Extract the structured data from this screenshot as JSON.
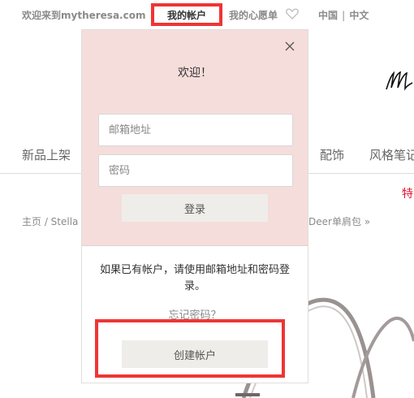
{
  "header": {
    "welcome": "欢迎来到mytheresa.com",
    "my_account": "我的帐户",
    "wishlist": "我的心愿单",
    "country": "中国",
    "language": "中文",
    "separator": "|"
  },
  "nav": {
    "new_arrivals": "新品上架",
    "accessories": "配饰",
    "style_notes": "风格笔记"
  },
  "promo": {
    "text": "特"
  },
  "breadcrumb": {
    "left": "主页 / Stella",
    "right": "Deer单肩包 »"
  },
  "login_popup": {
    "title": "欢迎！",
    "email_placeholder": "邮箱地址",
    "password_placeholder": "密码",
    "login_button": "登录",
    "info_text": "如果已有帐户，请使用邮箱地址和密码登录。",
    "forgot_password": "忘记密码？",
    "create_account": "创建帐户"
  },
  "colors": {
    "highlight": "#ee3535",
    "popup_background": "#f5dddb",
    "button_background": "#efede9",
    "promo": "#e0142d"
  },
  "icons": [
    "heart-icon",
    "close-icon",
    "logo-mark"
  ]
}
